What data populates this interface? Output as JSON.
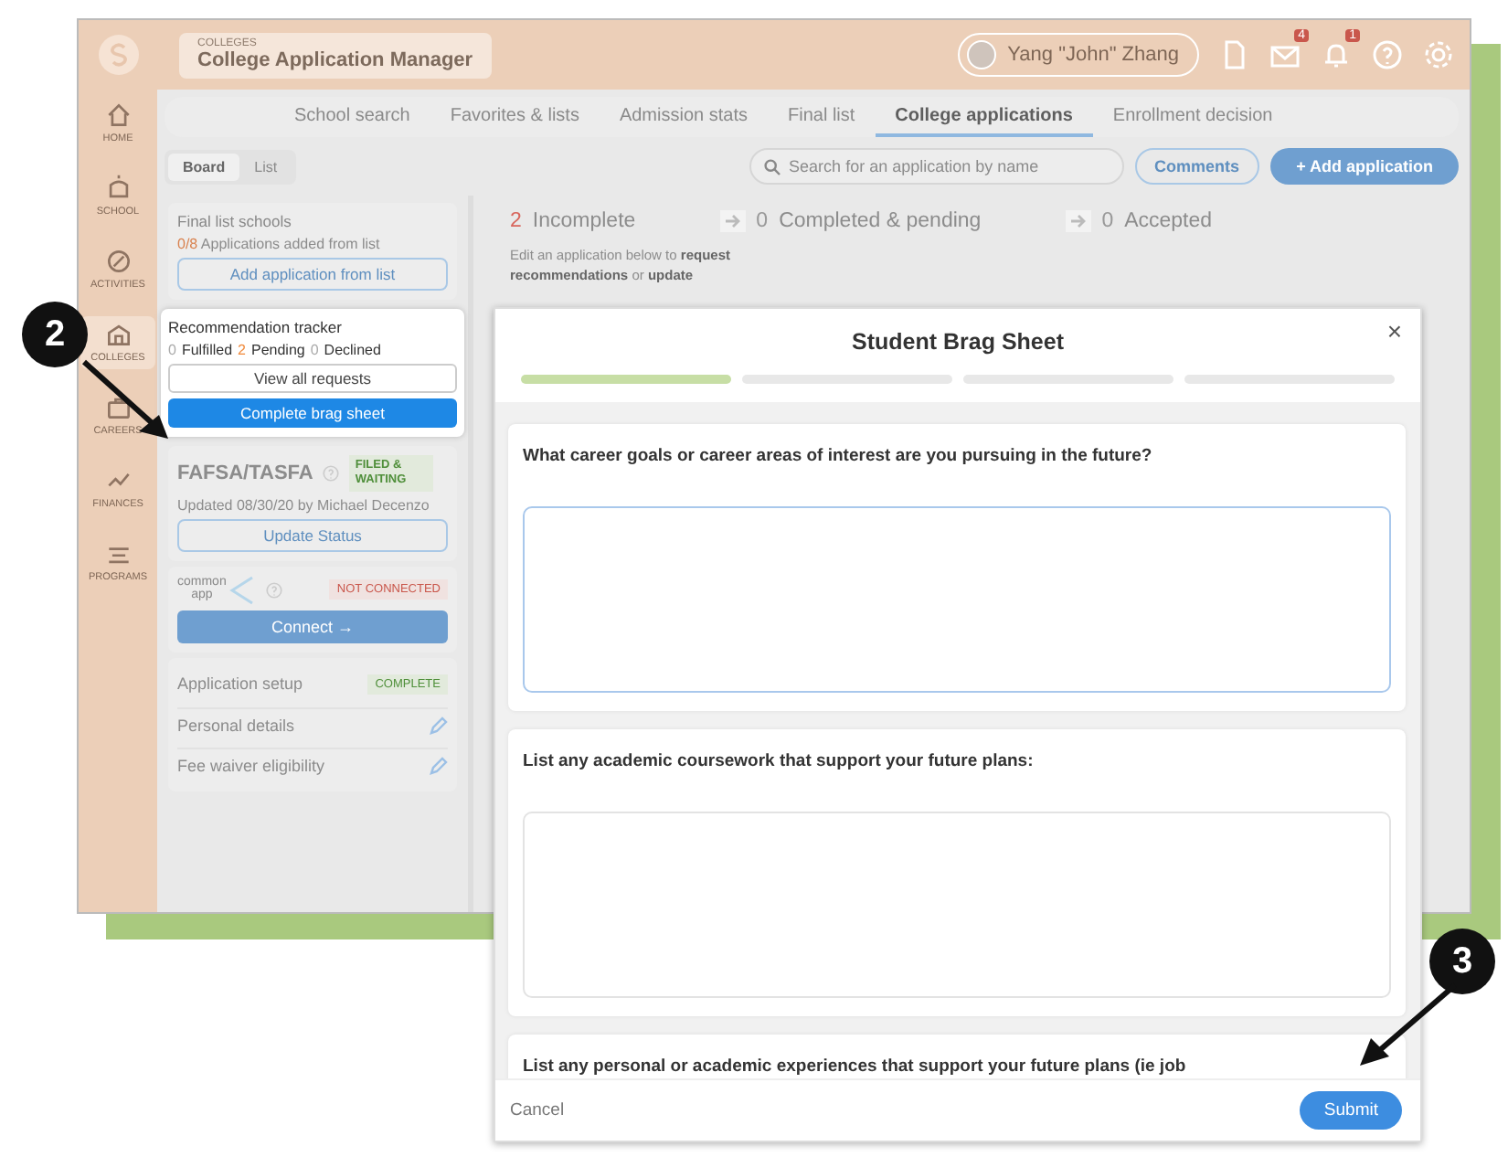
{
  "app": {
    "section_label": "COLLEGES",
    "title": "College Application Manager",
    "user": "Yang \"John\" Zhang",
    "header_icons": [
      {
        "kind": "document"
      },
      {
        "kind": "mail",
        "badge": "4"
      },
      {
        "kind": "bell",
        "badge": "1"
      },
      {
        "kind": "help"
      },
      {
        "kind": "settings"
      }
    ],
    "sidebar": {
      "items": [
        {
          "kind": "home",
          "label": "HOME",
          "selected": false
        },
        {
          "kind": "school",
          "label": "SCHOOL",
          "selected": false
        },
        {
          "kind": "activities",
          "label": "ACTIVITIES",
          "selected": false
        },
        {
          "kind": "colleges",
          "label": "COLLEGES",
          "selected": true
        },
        {
          "kind": "careers",
          "label": "CAREERS",
          "selected": false
        },
        {
          "kind": "finances",
          "label": "FINANCES",
          "selected": false
        },
        {
          "kind": "programs",
          "label": "PROGRAMS",
          "selected": false
        }
      ]
    },
    "tabs": [
      {
        "label": "School search",
        "selected": false
      },
      {
        "label": "Favorites & lists",
        "selected": false
      },
      {
        "label": "Admission stats",
        "selected": false
      },
      {
        "label": "Final list",
        "selected": false
      },
      {
        "label": "College applications",
        "selected": true
      },
      {
        "label": "Enrollment decision",
        "selected": false
      }
    ],
    "view_toggle": [
      {
        "label": "Board",
        "selected": true
      },
      {
        "label": "List",
        "selected": false
      }
    ],
    "search": {
      "placeholder": "Search for an application by name"
    },
    "comments_button": "Comments",
    "add_button": "+ Add application",
    "final_list": {
      "title": "Final list schools",
      "count": "0/8",
      "text": "Applications added from list",
      "button": "Add application from list"
    },
    "tracker": {
      "title": "Recommendation tracker",
      "stats": [
        {
          "count": "0",
          "label": "Fulfilled",
          "kind": "neutral"
        },
        {
          "count": "2",
          "label": "Pending",
          "kind": "pending"
        },
        {
          "count": "0",
          "label": "Declined",
          "kind": "neutral"
        }
      ],
      "view_button": "View all requests",
      "brag_button": "Complete brag sheet"
    },
    "fafsa": {
      "title": "FAFSA/TASFA",
      "status": "FILED & WAITING",
      "updated": "Updated 08/30/20 by Michael Decenzo",
      "button": "Update Status"
    },
    "common_app": {
      "logo_top": "common",
      "logo_bottom": "app",
      "status": "NOT CONNECTED",
      "button": "Connect →"
    },
    "setup": {
      "title": "Application setup",
      "status": "COMPLETE",
      "items": [
        "Personal details",
        "Fee waiver eligibility"
      ]
    },
    "columns": [
      {
        "count": "2",
        "label": "Incomplete",
        "kind": "alert"
      },
      {
        "count": "0",
        "label": "Completed & pending",
        "kind": "neutral"
      },
      {
        "count": "0",
        "label": "Accepted",
        "kind": "neutral"
      }
    ],
    "hint": "Edit an application below to **request recommendations** or **update**"
  },
  "modal": {
    "title": "Student Brag Sheet",
    "close": "×",
    "steps": [
      {
        "done": true
      },
      {
        "done": false
      },
      {
        "done": false
      },
      {
        "done": false
      }
    ],
    "questions": [
      {
        "text": "What career goals or career areas of interest are you pursuing in the future?",
        "focused": true
      },
      {
        "text": "List any academic coursework that support your future plans:",
        "focused": false
      },
      {
        "text": "List any personal or academic experiences that support your future plans (ie job"
      }
    ],
    "cancel": "Cancel",
    "submit": "Submit"
  },
  "callouts": [
    {
      "number": "2"
    },
    {
      "number": "3"
    }
  ]
}
